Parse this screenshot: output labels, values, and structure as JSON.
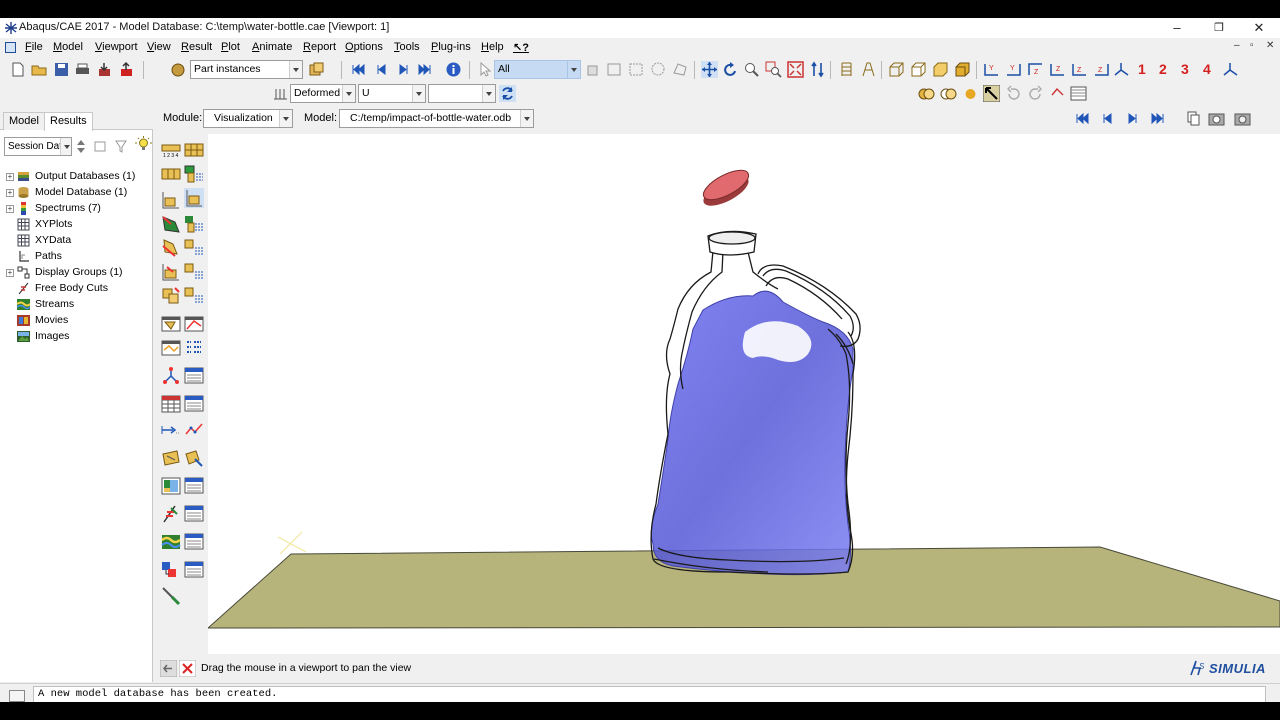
{
  "window": {
    "title": "Abaqus/CAE 2017 - Model Database: C:\\temp\\water-bottle.cae [Viewport: 1]",
    "minimize": "–",
    "restore": "❐",
    "close": "✕"
  },
  "menu": {
    "items": [
      "File",
      "Model",
      "Viewport",
      "View",
      "Result",
      "Plot",
      "Animate",
      "Report",
      "Options",
      "Tools",
      "Plug-ins",
      "Help"
    ],
    "help_pointer": "↖?"
  },
  "toolbar": {
    "part_instances": "Part instances",
    "selection": "All",
    "deformed": "Deformed",
    "variable": "U",
    "viewport_numbers": [
      "1",
      "2",
      "3",
      "4"
    ]
  },
  "context": {
    "module_label": "Module:",
    "module_value": "Visualization",
    "model_label": "Model:",
    "model_value": "C:/temp/impact-of-bottle-water.odb"
  },
  "tree": {
    "tabs": [
      "Model",
      "Results"
    ],
    "active_tab": "Results",
    "filter": "Session Data",
    "items": [
      {
        "label": "Output Databases (1)",
        "expandable": true,
        "icon": "database-icon"
      },
      {
        "label": "Model Database (1)",
        "expandable": true,
        "icon": "model-database-icon"
      },
      {
        "label": "Spectrums (7)",
        "expandable": true,
        "icon": "spectrum-icon"
      },
      {
        "label": "XYPlots",
        "expandable": false,
        "icon": "xyplot-icon"
      },
      {
        "label": "XYData",
        "expandable": false,
        "icon": "xydata-icon"
      },
      {
        "label": "Paths",
        "expandable": false,
        "icon": "path-icon"
      },
      {
        "label": "Display Groups (1)",
        "expandable": true,
        "icon": "display-group-icon"
      },
      {
        "label": "Free Body Cuts",
        "expandable": false,
        "icon": "free-body-icon"
      },
      {
        "label": "Streams",
        "expandable": false,
        "icon": "stream-icon"
      },
      {
        "label": "Movies",
        "expandable": false,
        "icon": "movie-icon"
      },
      {
        "label": "Images",
        "expandable": false,
        "icon": "image-icon"
      }
    ]
  },
  "prompt": {
    "text": "Drag the mouse in a viewport to pan the view"
  },
  "brand": {
    "logo": "SIMULIA"
  },
  "message_area": {
    "text": "A new model database has been created."
  },
  "colors": {
    "water": "#5a5ee0",
    "floor": "#b8b57a",
    "cap": "#e06a6e"
  }
}
